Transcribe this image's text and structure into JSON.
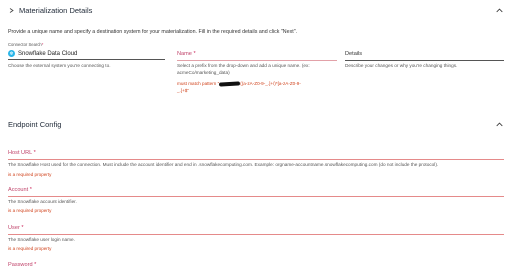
{
  "materialization": {
    "title": "Materialization Details",
    "intro": "Provide a unique name and specify a destination system for your materialization. Fill in the required details and click \"Next\".",
    "connector": {
      "label": "Connector Search",
      "required_mark": "*",
      "value": "Snowflake Data Cloud",
      "helper": "Choose the external system you're connecting to."
    },
    "name": {
      "label": "Name",
      "required_mark": "*",
      "helper_line1": "Select a prefix from the drop-down and add a unique name. (ex:",
      "helper_line2": "acmeCo/marketing_data)",
      "error_prefix": "must match pattern \"",
      "error_suffix": "((a-zA-Z0-9-_.]+/)*[a-zA-Z0-9-",
      "error_line2": "_.]+$\""
    },
    "details": {
      "label": "Details",
      "helper": "Describe your changes or why you're changing things."
    }
  },
  "endpoint": {
    "title": "Endpoint Config",
    "fields": [
      {
        "label": "Host URL",
        "required_mark": "*",
        "helper": "The Snowflake Host used for the connection. Must include the account identifier and end in .snowflakecomputing.com. Example: orgname-accountname.snowflakecomputing.com (do not include the protocol).",
        "error": "is a required property"
      },
      {
        "label": "Account",
        "required_mark": "*",
        "helper": "The Snowflake account identifier.",
        "error": "is a required property"
      },
      {
        "label": "User",
        "required_mark": "*",
        "helper": "The Snowflake user login name.",
        "error": "is a required property"
      },
      {
        "label": "Password",
        "required_mark": "*"
      }
    ]
  },
  "colors": {
    "accent": "#29b5e8",
    "error": "#d0421b",
    "required": "#cc2b5e"
  }
}
